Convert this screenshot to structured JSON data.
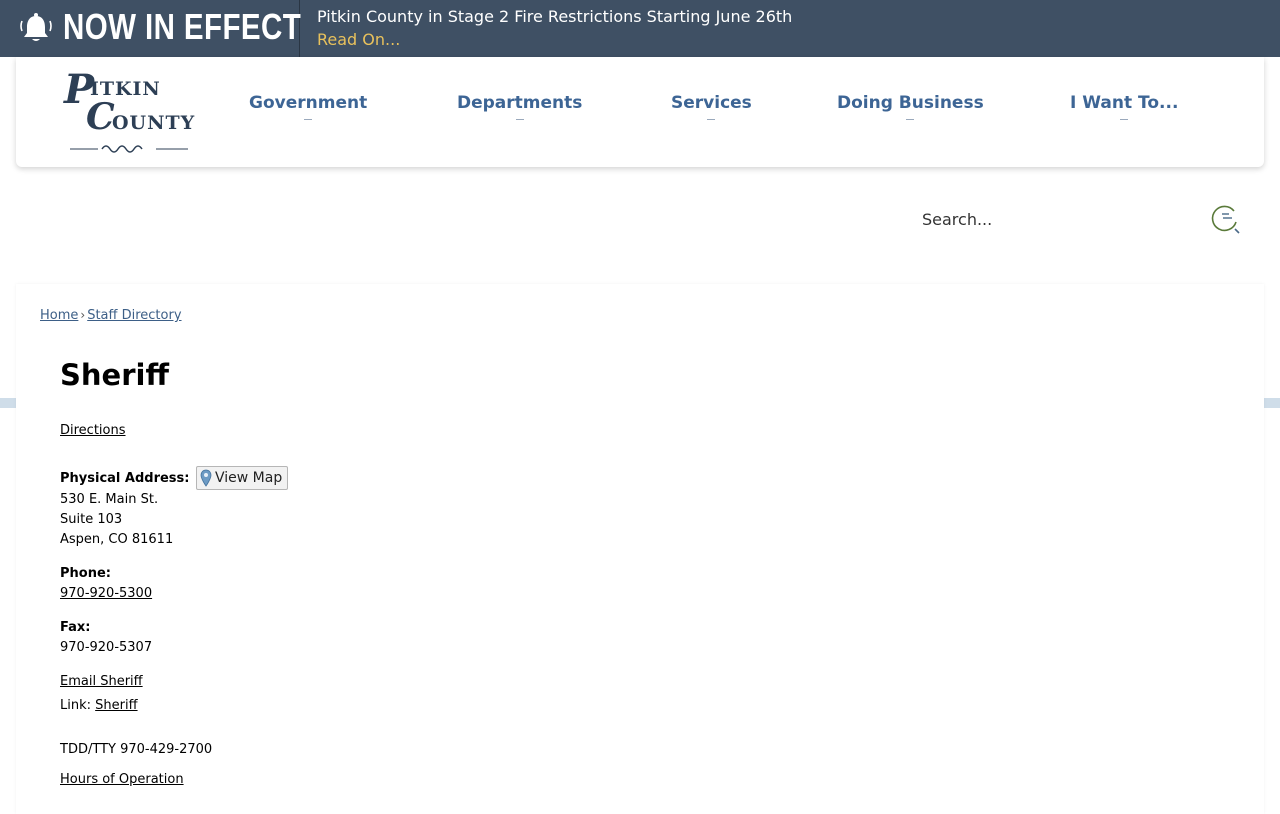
{
  "alert": {
    "title": "NOW IN EFFECT",
    "message": "Pitkin County in Stage 2 Fire Restrictions Starting June 26th",
    "link_label": "Read On..."
  },
  "logo": {
    "line1": "PITKIN",
    "line2": "COUNTY"
  },
  "nav": {
    "items": [
      {
        "label": "Government"
      },
      {
        "label": "Departments"
      },
      {
        "label": "Services"
      },
      {
        "label": "Doing Business"
      },
      {
        "label": "I Want To..."
      }
    ]
  },
  "search": {
    "placeholder": "Search..."
  },
  "breadcrumb": {
    "home": "Home",
    "separator": "›",
    "current": "Staff Directory"
  },
  "page": {
    "title": "Sheriff",
    "directions_label": "Directions",
    "physical_address_label": "Physical Address:",
    "view_map_label": "View Map",
    "address_line1": "530 E. Main St.",
    "address_line2": "Suite 103",
    "address_line3": "Aspen, CO 81611",
    "phone_label": "Phone:",
    "phone_value": "970-920-5300",
    "fax_label": "Fax:",
    "fax_value": "970-920-5307",
    "email_label": "Email Sheriff",
    "link_prefix": "Link:",
    "link_label": "Sheriff",
    "tdd_text": "TDD/TTY 970-429-2700",
    "hours_label": "Hours of Operation"
  },
  "colors": {
    "alert_bg": "#3f5064",
    "alert_link": "#e8c15c",
    "nav_text": "#3d6595",
    "link": "#3d5f87"
  }
}
